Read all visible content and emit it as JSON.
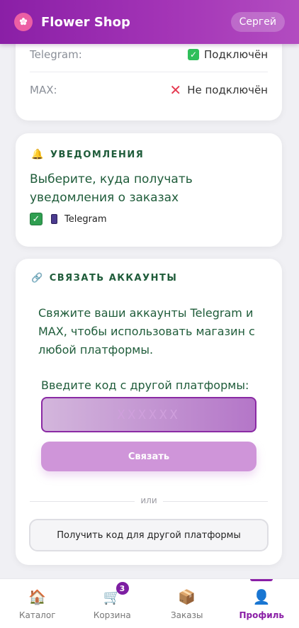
{
  "header": {
    "title": "Flower Shop",
    "logo_glyph": "✿",
    "user_name": "Сергей"
  },
  "connections": {
    "telegram_label": "Telegram:",
    "telegram_status": "Подключён",
    "telegram_icon": "check-icon",
    "max_label": "MAX:",
    "max_status": "Не подключён",
    "max_icon": "cross-icon"
  },
  "notifications": {
    "icon": "bell-icon",
    "title": "УВЕДОМЛЕНИЯ",
    "description": "Выберите, куда получать уведомления о заказах",
    "telegram_option": "Telegram",
    "telegram_checked": true
  },
  "link_accounts": {
    "icon": "link-icon",
    "title": "СВЯЗАТЬ АККАУНТЫ",
    "description": "Свяжите ваши аккаунты Telegram и MAX, чтобы использовать магазин с любой платформы.",
    "code_label": "Введите код с другой платформы:",
    "code_placeholder": "XXXXXX",
    "bind_button": "Связать",
    "divider_text": "или",
    "get_code_button": "Получить код для другой платформы"
  },
  "bottom_nav": {
    "items": [
      {
        "label": "Каталог",
        "icon": "🏠"
      },
      {
        "label": "Корзина",
        "icon": "🛒",
        "badge": "3"
      },
      {
        "label": "Заказы",
        "icon": "📦"
      },
      {
        "label": "Профиль",
        "icon": "👤"
      }
    ],
    "active": "Профиль"
  },
  "colors": {
    "accent": "#8a1fa6",
    "heading_green": "#1f5c3a",
    "success": "#2fbf5a",
    "error": "#e53950"
  }
}
